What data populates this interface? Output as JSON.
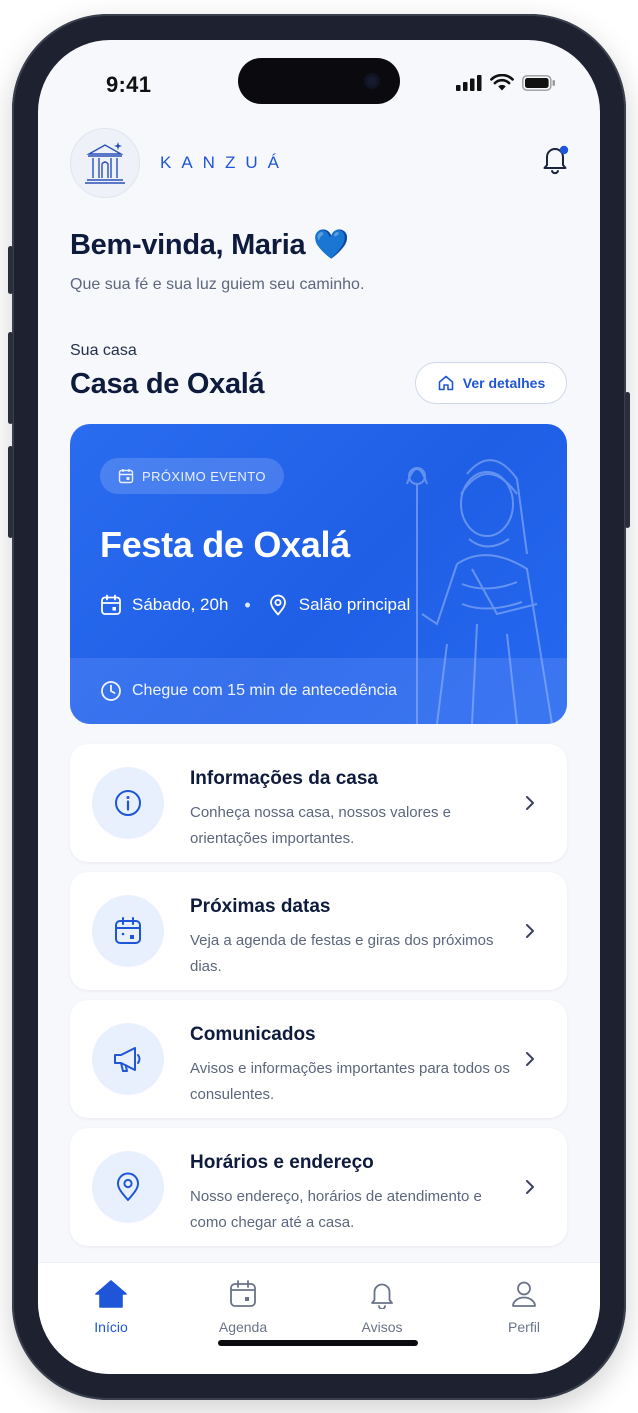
{
  "status_bar": {
    "time": "9:41"
  },
  "brand": {
    "name": "KANZUÁ"
  },
  "greeting": {
    "title": "Bem-vinda, Maria 💙",
    "subtitle": "Que sua fé e sua luz guiem seu caminho."
  },
  "house": {
    "label": "Sua casa",
    "name": "Casa de Oxalá",
    "details_button": "Ver detalhes"
  },
  "event": {
    "pill": "PRÓXIMO EVENTO",
    "title": "Festa de Oxalá",
    "date": "Sábado, 20h",
    "separator": "•",
    "location": "Salão principal",
    "notice": "Chegue com 15 min de antecedência"
  },
  "menu": [
    {
      "title": "Informações da casa",
      "desc": "Conheça nossa casa, nossos valores e orientações importantes.",
      "icon": "info-icon"
    },
    {
      "title": "Próximas datas",
      "desc": "Veja a agenda de festas e giras dos próximos dias.",
      "icon": "calendar-icon"
    },
    {
      "title": "Comunicados",
      "desc": "Avisos e informações importantes para todos os consulentes.",
      "icon": "megaphone-icon"
    },
    {
      "title": "Horários e endereço",
      "desc": "Nosso endereço, horários de atendimento e como chegar até a casa.",
      "icon": "location-pin-icon"
    }
  ],
  "tabs": [
    {
      "label": "Início",
      "icon": "home-icon",
      "active": true
    },
    {
      "label": "Agenda",
      "icon": "calendar-icon",
      "active": false
    },
    {
      "label": "Avisos",
      "icon": "bell-icon",
      "active": false
    },
    {
      "label": "Perfil",
      "icon": "user-icon",
      "active": false
    }
  ],
  "colors": {
    "accent": "#1f56d8",
    "card_blue": "#2563eb",
    "background": "#f7f8fb",
    "text": "#0f1b3d",
    "muted": "#5c667c"
  }
}
